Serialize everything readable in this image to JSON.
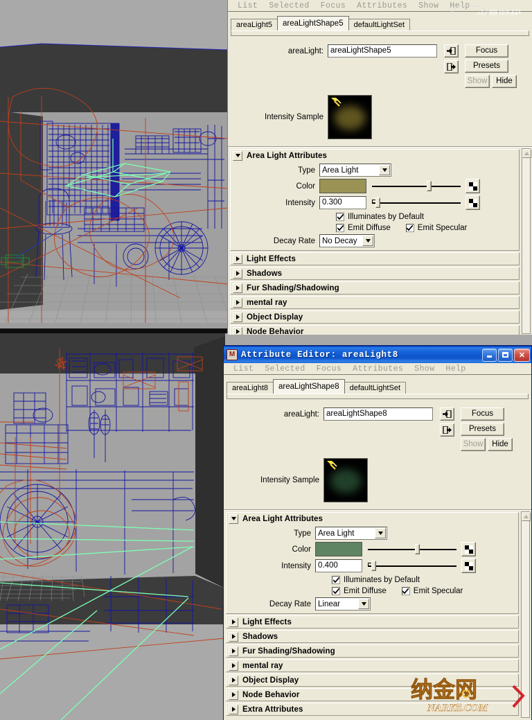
{
  "panels": [
    {
      "id": "top",
      "has_titlebar": false,
      "window_title": "",
      "menus": [
        "List",
        "Selected",
        "Focus",
        "Attributes",
        "Show",
        "Help"
      ],
      "tabs": [
        {
          "label": "areaLight5",
          "active": false
        },
        {
          "label": "areaLightShape5",
          "active": true
        },
        {
          "label": "defaultLightSet",
          "active": false
        }
      ],
      "name_row": {
        "label": "areaLight:",
        "value": "areaLightShape5",
        "icon_buttons": [
          "arrow-into-box-icon",
          "arrow-out-of-box-icon"
        ],
        "buttons": [
          "Focus",
          "Presets"
        ],
        "show_label": "Show",
        "hide_label": "Hide",
        "show_disabled": true
      },
      "intensity_sample": {
        "label": "Intensity Sample",
        "glow_color": "#5f5520",
        "icon": "light-bulb-icon"
      },
      "section": {
        "title": "Area Light Attributes",
        "expanded": true,
        "type_label": "Type",
        "type_value": "Area Light",
        "color_label": "Color",
        "color_value": "#9a9355",
        "color_slider_pct": 62,
        "intensity_label": "Intensity",
        "intensity_value": "0.300",
        "intensity_slider_pct": 4,
        "checkboxes": [
          {
            "label": "Illuminates by Default",
            "checked": true
          },
          {
            "label": "Emit Diffuse",
            "checked": true
          },
          {
            "label": "Emit Specular",
            "checked": true
          }
        ],
        "decay_label": "Decay Rate",
        "decay_value": "No Decay"
      },
      "collapsed_sections": [
        "Light Effects",
        "Shadows",
        "Fur Shading/Shadowing",
        "mental ray",
        "Object Display",
        "Node Behavior"
      ]
    },
    {
      "id": "bottom",
      "has_titlebar": true,
      "window_title": "Attribute Editor: areaLight8",
      "titlebar_buttons": [
        "minimize-button",
        "maximize-button",
        "close-button"
      ],
      "menus": [
        "List",
        "Selected",
        "Focus",
        "Attributes",
        "Show",
        "Help"
      ],
      "tabs": [
        {
          "label": "areaLight8",
          "active": false
        },
        {
          "label": "areaLightShape8",
          "active": true
        },
        {
          "label": "defaultLightSet",
          "active": false
        }
      ],
      "name_row": {
        "label": "areaLight:",
        "value": "areaLightShape8",
        "icon_buttons": [
          "arrow-into-box-icon",
          "arrow-out-of-box-icon"
        ],
        "buttons": [
          "Focus",
          "Presets"
        ],
        "show_label": "Show",
        "hide_label": "Hide",
        "show_disabled": true
      },
      "intensity_sample": {
        "label": "Intensity Sample",
        "glow_color": "#21402a",
        "icon": "light-bulb-icon"
      },
      "section": {
        "title": "Area Light Attributes",
        "expanded": true,
        "type_label": "Type",
        "type_value": "Area Light",
        "color_label": "Color",
        "color_value": "#5f8463",
        "color_slider_pct": 53,
        "intensity_label": "Intensity",
        "intensity_value": "0.400",
        "intensity_slider_pct": 4,
        "checkboxes": [
          {
            "label": "Illuminates by Default",
            "checked": true
          },
          {
            "label": "Emit Diffuse",
            "checked": true
          },
          {
            "label": "Emit Specular",
            "checked": true
          }
        ],
        "decay_label": "Decay Rate",
        "decay_value": "Linear"
      },
      "collapsed_sections": [
        "Light Effects",
        "Shadows",
        "Fur Shading/Shadowing",
        "mental ray",
        "Object Display",
        "Node Behavior",
        "Extra Attributes"
      ]
    }
  ],
  "viewports": {
    "top": {
      "description": "Maya perspective viewport, wireframe shaded workshop scene",
      "background_color": "#a9a9a9",
      "wireframe_color": "#1414a0",
      "curve_color": "#c0401a",
      "light_gizmo_color": "#7dffb4",
      "ground_color": "#3a3a3a"
    },
    "bottom": {
      "description": "Maya perspective viewport, wireframe shaded workshop interior",
      "background_color": "#a9a9a9",
      "wireframe_color": "#1414a0",
      "curve_color": "#c0401a",
      "light_gizmo_color": "#7dffb4",
      "ground_color": "#3a3a3a"
    }
  },
  "watermarks": {
    "top_right": "www.hxsd.com",
    "bottom_right": "NARKii.COM"
  }
}
